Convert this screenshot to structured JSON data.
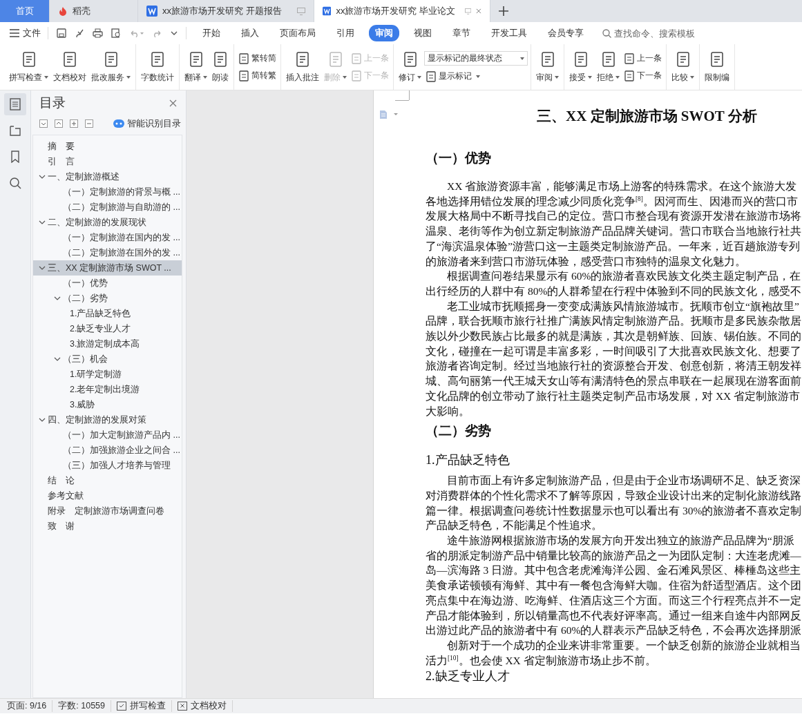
{
  "tabs": [
    {
      "kind": "home",
      "label": "首页",
      "selected": false
    },
    {
      "kind": "docer",
      "label": "稻壳",
      "selected": false
    },
    {
      "kind": "doc",
      "label": "xx旅游市场开发研究 开题报告",
      "selected": false
    },
    {
      "kind": "doc",
      "label": "xx旅游市场开发研究 毕业论文",
      "selected": true
    }
  ],
  "menu": {
    "file": "文件",
    "tabs": [
      {
        "label": "开始",
        "selected": false
      },
      {
        "label": "插入",
        "selected": false
      },
      {
        "label": "页面布局",
        "selected": false
      },
      {
        "label": "引用",
        "selected": false
      },
      {
        "label": "审阅",
        "selected": true
      },
      {
        "label": "视图",
        "selected": false
      },
      {
        "label": "章节",
        "selected": false
      },
      {
        "label": "开发工具",
        "selected": false
      },
      {
        "label": "会员专享",
        "selected": false
      }
    ],
    "search": {
      "placeholder": "查找命令、搜索模板"
    }
  },
  "ribbon": {
    "groups": [
      {
        "items": [
          {
            "kind": "large",
            "label": "拼写检查",
            "dropdown": true,
            "disabled": false
          },
          {
            "kind": "large",
            "label": "文档校对",
            "dropdown": false,
            "disabled": false
          },
          {
            "kind": "large",
            "label": "批改服务",
            "dropdown": true,
            "disabled": false
          }
        ]
      },
      {
        "items": [
          {
            "kind": "large",
            "label": "字数统计",
            "dropdown": false,
            "disabled": false
          }
        ]
      },
      {
        "items": [
          {
            "kind": "large",
            "label": "翻译",
            "dropdown": true,
            "disabled": false
          },
          {
            "kind": "large",
            "label": "朗读",
            "dropdown": false,
            "disabled": false
          }
        ]
      },
      {
        "items": [
          {
            "kind": "stack",
            "items": [
              {
                "kind": "button",
                "label": "繁转简",
                "dropdown": false,
                "disabled": false
              },
              {
                "kind": "button",
                "label": "简转繁",
                "dropdown": false,
                "disabled": false
              }
            ]
          }
        ]
      },
      {
        "items": [
          {
            "kind": "large",
            "label": "插入批注",
            "dropdown": false,
            "disabled": false
          },
          {
            "kind": "large",
            "label": "删除",
            "dropdown": true,
            "disabled": true
          },
          {
            "kind": "stack",
            "items": [
              {
                "kind": "button",
                "label": "上一条",
                "dropdown": false,
                "disabled": true
              },
              {
                "kind": "button",
                "label": "下一条",
                "dropdown": false,
                "disabled": true
              }
            ]
          }
        ]
      },
      {
        "items": [
          {
            "kind": "large",
            "label": "修订",
            "dropdown": true,
            "disabled": false
          },
          {
            "kind": "stack",
            "items": [
              {
                "kind": "select",
                "label": "显示标记的最终状态",
                "dropdown": true
              },
              {
                "kind": "button",
                "label": "显示标记",
                "dropdown": true,
                "disabled": false
              }
            ]
          }
        ]
      },
      {
        "items": [
          {
            "kind": "large",
            "label": "审阅",
            "dropdown": true,
            "disabled": false
          }
        ]
      },
      {
        "items": [
          {
            "kind": "large",
            "label": "接受",
            "dropdown": true,
            "disabled": false
          },
          {
            "kind": "large",
            "label": "拒绝",
            "dropdown": true,
            "disabled": false
          },
          {
            "kind": "stack",
            "items": [
              {
                "kind": "button",
                "label": "上一条",
                "dropdown": false,
                "disabled": false
              },
              {
                "kind": "button",
                "label": "下一条",
                "dropdown": false,
                "disabled": false
              }
            ]
          }
        ]
      },
      {
        "items": [
          {
            "kind": "large",
            "label": "比较",
            "dropdown": true,
            "disabled": false
          }
        ]
      },
      {
        "items": [
          {
            "kind": "large",
            "label": "限制编",
            "dropdown": false,
            "disabled": false
          }
        ]
      }
    ]
  },
  "sidebar": {
    "icons": [
      {
        "selected": true
      },
      {
        "selected": false
      },
      {
        "selected": false
      },
      {
        "selected": false
      }
    ],
    "toc": {
      "title": "目录",
      "smart_button": "智能识别目录",
      "items": [
        {
          "label": "摘　要",
          "selected": false
        },
        {
          "label": "引　言",
          "selected": false
        },
        {
          "label": "一、定制旅游概述",
          "selected": false,
          "expanded": true,
          "children": [
            {
              "label": "（一）定制旅游的背景与概 ...",
              "selected": false
            },
            {
              "label": "（二）定制旅游与自助游的 ...",
              "selected": false
            }
          ]
        },
        {
          "label": "二、定制旅游的发展现状",
          "selected": false,
          "expanded": true,
          "children": [
            {
              "label": "（一）定制旅游在国内的发 ...",
              "selected": false
            },
            {
              "label": "（二）定制旅游在国外的发 ...",
              "selected": false
            }
          ]
        },
        {
          "label": "三、XX 定制旅游市场 SWOT ...",
          "selected": true,
          "expanded": true,
          "children": [
            {
              "label": "（一）优势",
              "selected": false
            },
            {
              "label": "（二）劣势",
              "selected": false,
              "expanded": true,
              "children": [
                {
                  "label": "1.产品缺乏特色",
                  "selected": false
                },
                {
                  "label": "2.缺乏专业人才",
                  "selected": false
                },
                {
                  "label": "3.旅游定制成本高",
                  "selected": false
                }
              ]
            },
            {
              "label": "（三）机会",
              "selected": false,
              "expanded": true,
              "children": [
                {
                  "label": "1.研学定制游",
                  "selected": false
                },
                {
                  "label": "2.老年定制出境游",
                  "selected": false
                },
                {
                  "label": "3.威胁",
                  "selected": false
                }
              ]
            }
          ]
        },
        {
          "label": "四、定制旅游的发展对策",
          "selected": false,
          "expanded": true,
          "children": [
            {
              "label": "（一）加大定制旅游产品内 ...",
              "selected": false
            },
            {
              "label": "（二）加强旅游企业之间合 ...",
              "selected": false
            },
            {
              "label": "（三）加强人才培养与管理",
              "selected": false
            }
          ]
        },
        {
          "label": "结　论",
          "selected": false
        },
        {
          "label": "参考文献",
          "selected": false
        },
        {
          "label": "附录　定制旅游市场调查问卷",
          "selected": false
        },
        {
          "label": "致　谢",
          "selected": false
        }
      ]
    }
  },
  "document": {
    "blocks": [
      {
        "kind": "title",
        "lines": [
          "三、XX 定制旅游市场 SWOT 分析"
        ]
      },
      {
        "kind": "heading",
        "lines": [
          "（一）优势"
        ]
      },
      {
        "kind": "paragraph",
        "lines": [
          "XX 省旅游资源丰富，能够满足市场上游客的特殊需求。在这个旅游大发",
          "各地选择用错位发展的理念减少同质化竞争$^{[8]}$。因河而生、因港而兴的营口市",
          "发展大格局中不断寻找自己的定位。营口市整合现有资源开发潜在旅游市场将",
          "温泉、老街等作为创立新定制旅游产品品牌关键词。营口市联合当地旅行社共",
          "了“海滨温泉体验”游营口这一主题类定制旅游产品。一年来，近百趟旅游专列",
          "的旅游者来到营口市游玩体验，感受营口市独特的温泉文化魅力。"
        ]
      },
      {
        "kind": "paragraph",
        "lines": [
          "根据调查问卷结果显示有 60%的旅游者喜欢民族文化类主题定制产品，在",
          "出行经历的人群中有 80%的人群希望在行程中体验到不同的民族文化，感受不"
        ]
      },
      {
        "kind": "paragraph",
        "lines": [
          "老工业城市抚顺摇身一变变成满族风情旅游城市。抚顺市创立“旗袍故里”",
          "品牌，联合抚顺市旅行社推广满族风情定制旅游产品。抚顺市是多民族杂散居",
          "族以外少数民族占比最多的就是满族，其次是朝鲜族、回族、锡伯族。不同的",
          "文化，碰撞在一起可谓是丰富多彩，一时间吸引了大批喜欢民族文化、想要了",
          "旅游者咨询定制。经过当地旅行社的资源整合开发、创意创新，将清王朝发祥",
          "城、高句丽第一代王城天女山等有满清特色的景点串联在一起展现在游客面前",
          "文化品牌的创立带动了旅行社主题类定制产品市场发展，对 XX 省定制旅游市",
          "大影响。"
        ]
      },
      {
        "kind": "heading",
        "lines": [
          "（二）劣势"
        ]
      },
      {
        "kind": "subheading",
        "lines": [
          "1.产品缺乏特色"
        ]
      },
      {
        "kind": "paragraph",
        "lines": [
          "目前市面上有许多定制旅游产品，但是由于企业市场调研不足、缺乏资深",
          "对消费群体的个性化需求不了解等原因，导致企业设计出来的定制化旅游线路",
          "篇一律。根据调查问卷统计性数据显示也可以看出有 30%的旅游者不喜欢定制",
          "产品缺乏特色，不能满足个性追求。"
        ]
      },
      {
        "kind": "paragraph",
        "lines": [
          "途牛旅游网根据旅游市场的发展方向开发出独立的旅游产品品牌为“朋派",
          "省的朋派定制游产品中销量比较高的旅游产品之一为团队定制：大连老虎滩—",
          "岛—滨海路 3 日游。其中包含老虎滩海洋公园、金石滩风景区、棒棰岛这些主",
          "美食承诺顿顿有海鲜、其中有一餐包含海鲜大咖。住宿为舒适型酒店。这个团",
          "亮点集中在海边游、吃海鲜、住酒店这三个方面。而这三个行程亮点并不一定",
          "产品才能体验到，所以销量高也不代表好评率高。通过一组来自途牛内部网反",
          "出游过此产品的旅游者中有 60%的人群表示产品缺乏特色，不会再次选择朋派"
        ]
      },
      {
        "kind": "paragraph",
        "lines": [
          "创新对于一个成功的企业来讲非常重要。一个缺乏创新的旅游企业就相当",
          "活力$^{[10]}$。也会使 XX 省定制旅游市场止步不前。"
        ]
      },
      {
        "kind": "subheading",
        "lines": [
          "2.缺乏专业人才"
        ]
      }
    ]
  },
  "status_bar": {
    "page": "页面: 9/16",
    "words": "字数: 10559",
    "buttons": [
      "拼写检查",
      "文档校对"
    ]
  }
}
